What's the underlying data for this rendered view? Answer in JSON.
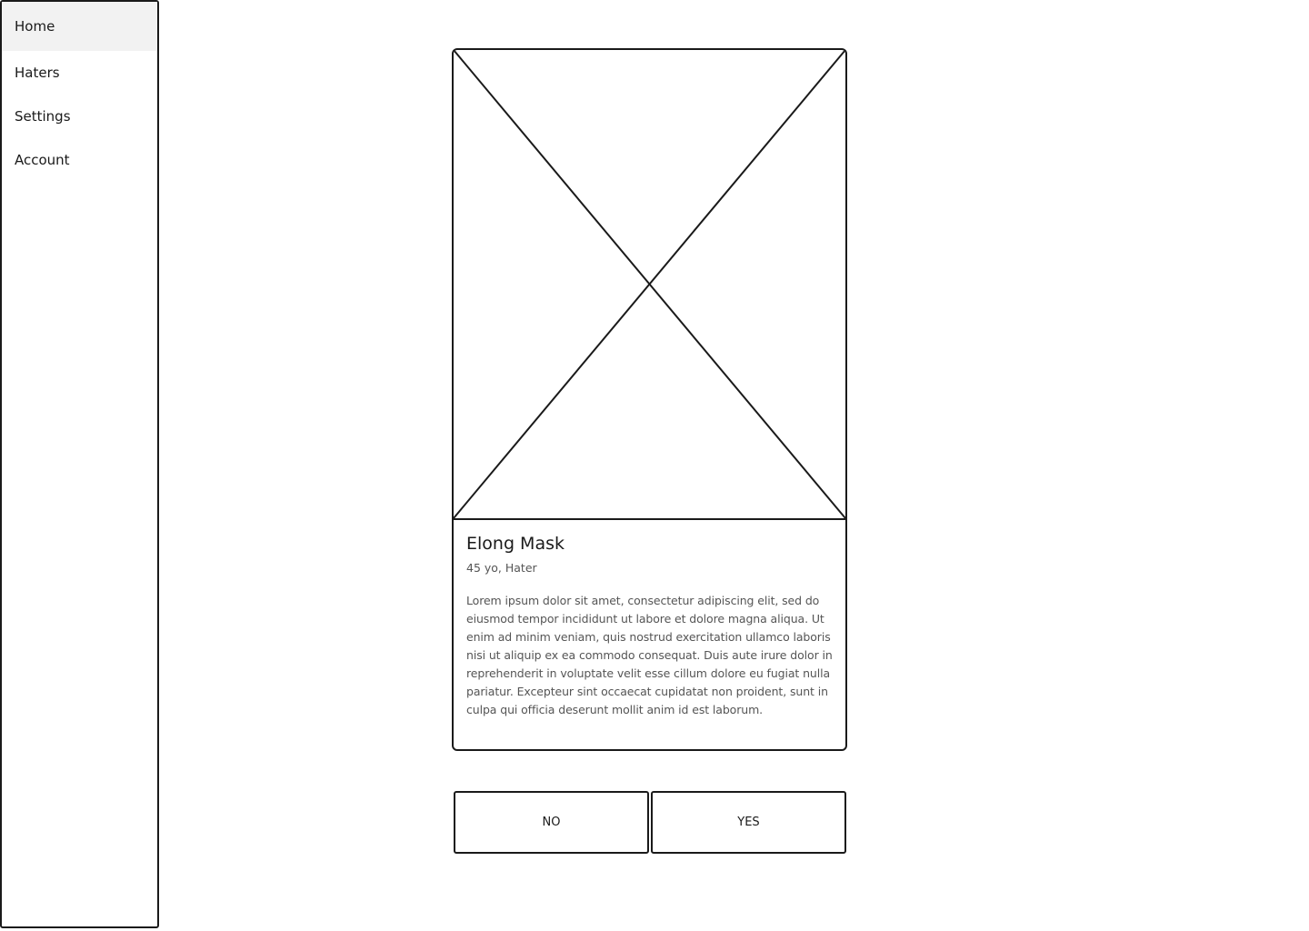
{
  "sidebar": {
    "items": [
      {
        "label": "Home",
        "active": true
      },
      {
        "label": "Haters",
        "active": false
      },
      {
        "label": "Settings",
        "active": false
      },
      {
        "label": "Account",
        "active": false
      }
    ]
  },
  "profile": {
    "image_icon": "image-placeholder-icon",
    "name": "Elong Mask",
    "meta": "45 yo, Hater",
    "bio": "Lorem ipsum dolor sit amet, consectetur adipiscing elit, sed do eiusmod  tempor incididunt ut labore et dolore magna aliqua. Ut enim ad minim  veniam, quis nostrud exercitation ullamco laboris nisi ut aliquip ex ea  commodo consequat. Duis aute irure dolor in reprehenderit in voluptate  velit esse cillum dolore eu fugiat nulla pariatur. Excepteur sint  occaecat cupidatat non proident, sunt in culpa qui officia deserunt  mollit anim id est laborum."
  },
  "actions": {
    "no_label": "NO",
    "yes_label": "YES"
  },
  "colors": {
    "stroke": "#1a1a1a",
    "active_nav_bg": "#f2f2f2",
    "secondary_text": "#555555"
  }
}
